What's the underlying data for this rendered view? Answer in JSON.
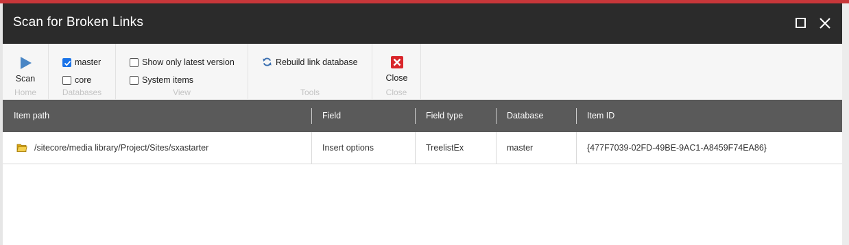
{
  "window": {
    "title": "Scan for Broken Links",
    "maximize_icon": "maximize-icon",
    "close_icon": "close-icon"
  },
  "ribbon": {
    "home": {
      "label": "Home",
      "scan_label": "Scan",
      "scan_icon": "play-icon"
    },
    "databases": {
      "label": "Databases",
      "items": [
        {
          "label": "master",
          "checked": true
        },
        {
          "label": "core",
          "checked": false
        }
      ]
    },
    "view": {
      "label": "View",
      "items": [
        {
          "label": "Show only latest version",
          "checked": false
        },
        {
          "label": "System items",
          "checked": false
        }
      ]
    },
    "tools": {
      "label": "Tools",
      "rebuild_label": "Rebuild link database",
      "rebuild_icon": "refresh-link-icon"
    },
    "close": {
      "label": "Close",
      "close_label": "Close",
      "close_icon": "red-x-icon"
    }
  },
  "grid": {
    "columns": [
      "Item path",
      "Field",
      "Field type",
      "Database",
      "Item ID"
    ],
    "rows": [
      {
        "icon": "folder-icon",
        "item_path": "/sitecore/media library/Project/Sites/sxastarter",
        "field": "Insert options",
        "field_type": "TreelistEx",
        "database": "master",
        "item_id": "{477F7039-02FD-49BE-9AC1-A8459F74EA86}"
      }
    ]
  },
  "colors": {
    "titlebar": "#2b2b2b",
    "grid_header": "#5a5a5a",
    "accent_red": "#c8373a",
    "play_blue": "#4a86c5"
  }
}
